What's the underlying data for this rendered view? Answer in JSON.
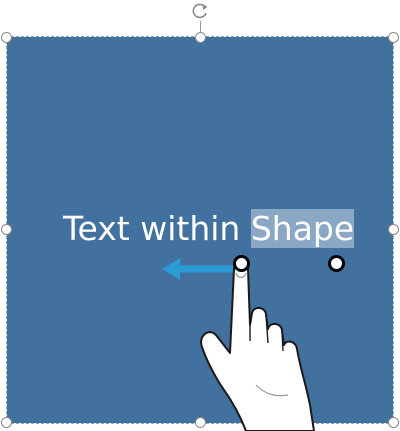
{
  "shape": {
    "fill": "#43719f",
    "text_before": "Text within ",
    "text_selected": "Shape"
  },
  "selection": {
    "border_color": "#8aa7c4",
    "handle_color": "#ffffff"
  },
  "accent": "#2a9bd4",
  "icons": {
    "rotate": "rotate-icon",
    "arrow": "left-arrow-icon",
    "hand": "hand-pointer-icon"
  }
}
